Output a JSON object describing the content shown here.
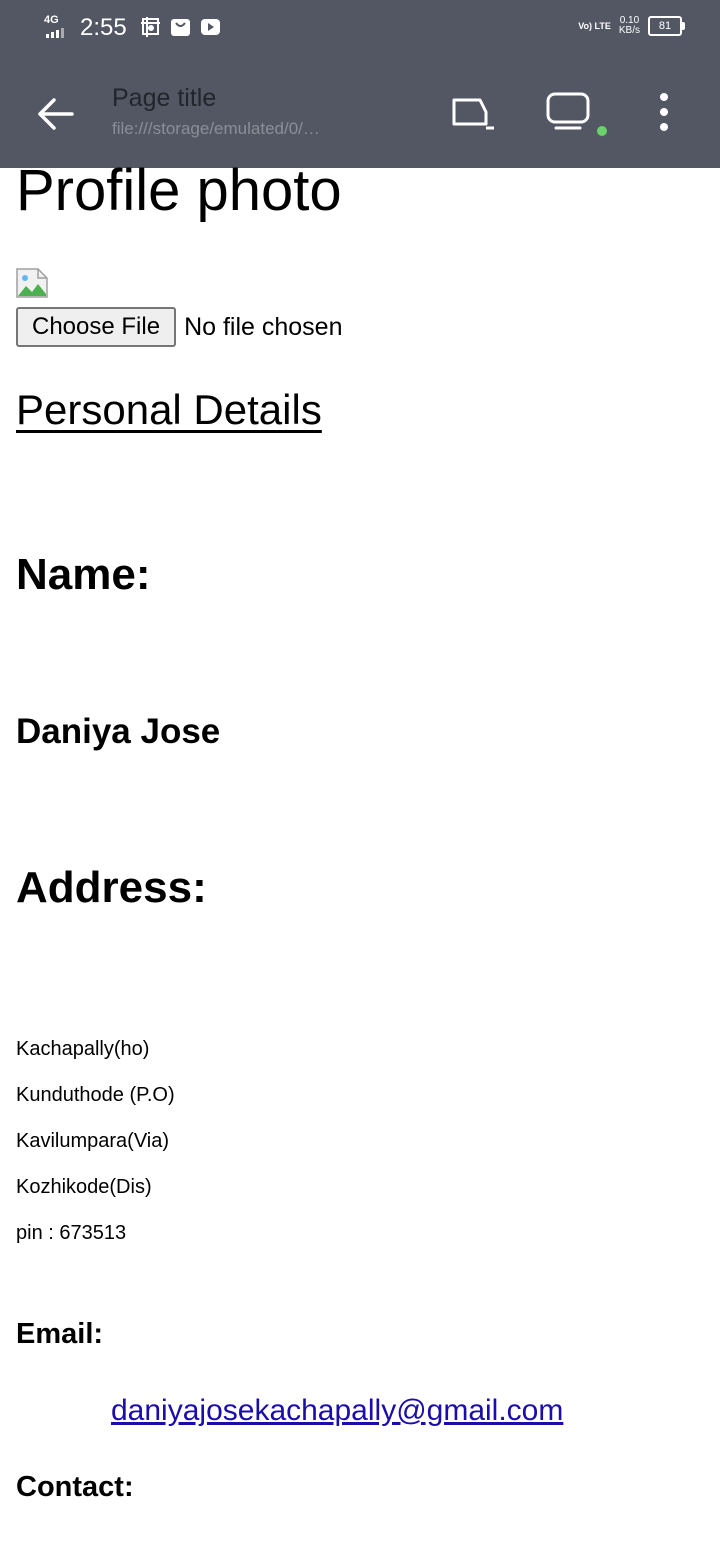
{
  "status_bar": {
    "network": "4G",
    "time": "2:55",
    "volte": "Vo) LTE",
    "speed_value": "0.10",
    "speed_unit": "KB/s",
    "battery": "81",
    "icons": [
      "screenshot-icon",
      "shop-bag-icon",
      "youtube-icon"
    ]
  },
  "app_bar": {
    "title": "Page title",
    "url": "file:///storage/emulated/0/…",
    "icons": [
      "back-arrow-icon",
      "cast-icon",
      "device-icon",
      "more-vert-icon"
    ],
    "status_dot_color": "#6bd16a",
    "background_color": "#535763"
  },
  "page": {
    "profile_heading": "Profile photo",
    "choose_file_label": "Choose File",
    "no_file_text": "No file chosen",
    "personal_heading": "Personal Details",
    "name_label": "Name:",
    "name_value": "Daniya Jose",
    "address_label": "Address:",
    "address_lines": [
      "Kachapally(ho)",
      "Kunduthode (P.O)",
      "Kavilumpara(Via)",
      "Kozhikode(Dis)",
      "pin : 673513"
    ],
    "email_label": "Email:",
    "email_value": "daniyajosekachapally@gmail.com",
    "contact_label": "Contact:",
    "link_color": "#1a0dab"
  }
}
